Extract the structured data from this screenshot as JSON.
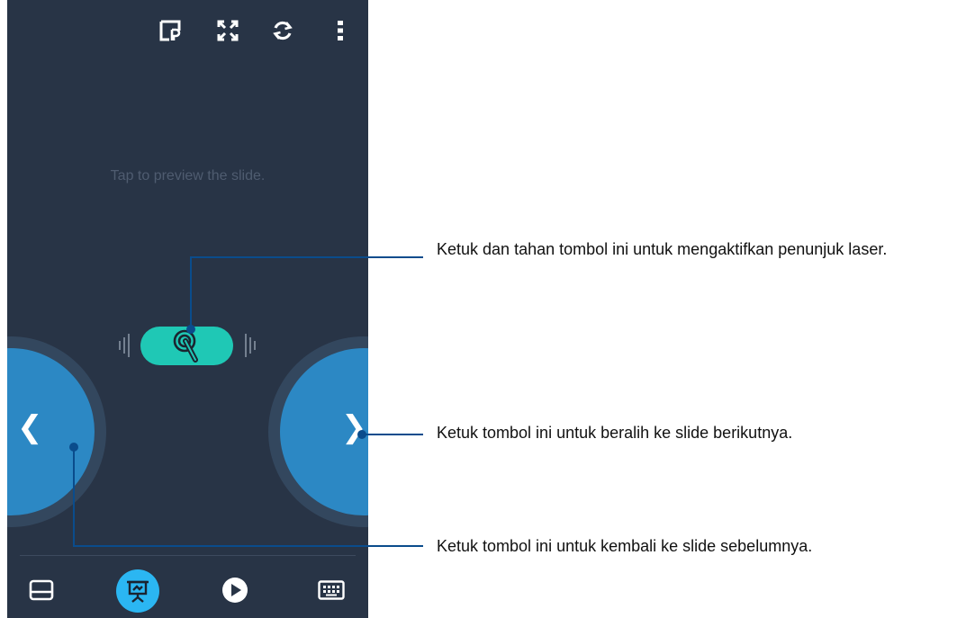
{
  "preview_hint": "Tap to preview the slide.",
  "callouts": {
    "laser": "Ketuk dan tahan tombol ini untuk mengaktifkan penunjuk laser.",
    "next": "Ketuk tombol ini untuk beralih ke slide berikutnya.",
    "prev": "Ketuk tombol ini untuk kembali ke slide sebelumnya."
  },
  "nav": {
    "prev_glyph": "❮",
    "next_glyph": "❯"
  },
  "icons": {
    "topbar": [
      "presenter-notes-icon",
      "fullscreen-icon",
      "refresh-icon",
      "more-vert-icon"
    ],
    "bottombar": [
      "touchpad-icon",
      "presentation-icon",
      "play-icon",
      "keyboard-icon"
    ]
  },
  "colors": {
    "background": "#283446",
    "laser_button": "#1fc8b5",
    "nav_button": "#2c88c4",
    "active_tab": "#2bb6f2",
    "callout_line": "#0a4c8c"
  }
}
